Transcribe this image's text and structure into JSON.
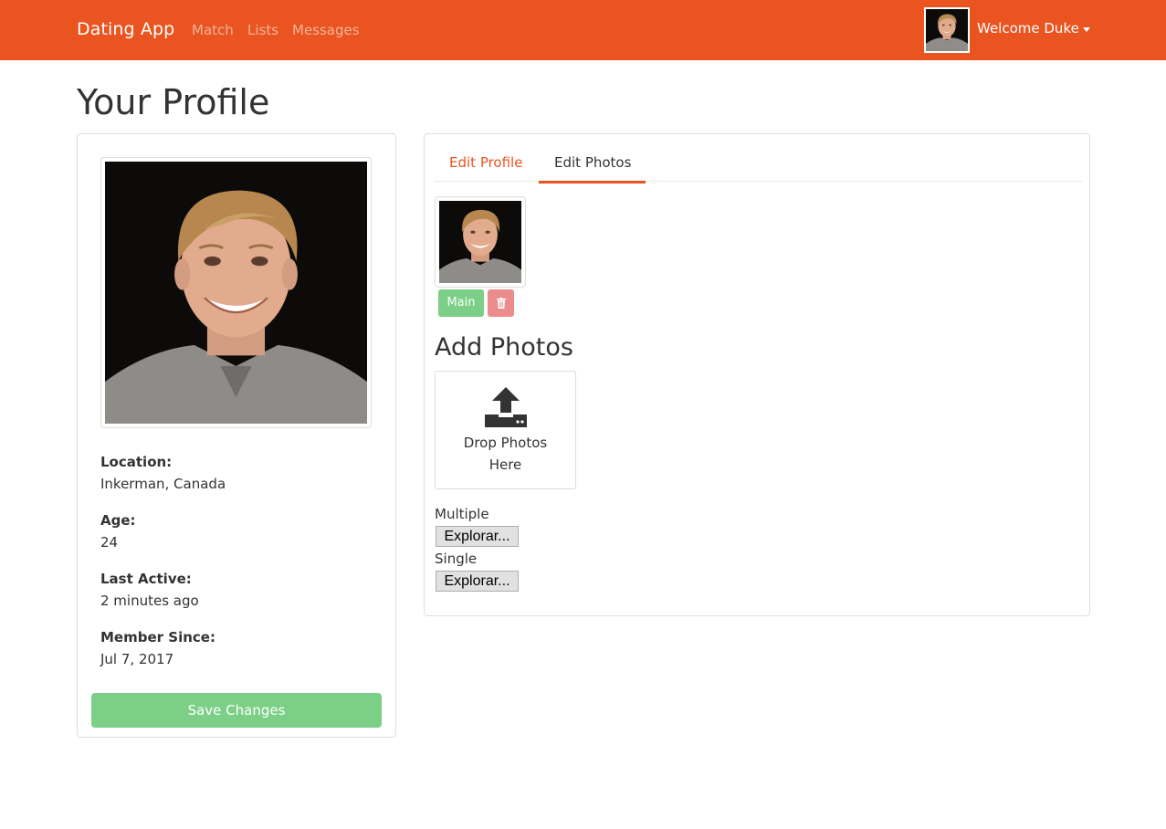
{
  "navbar": {
    "brand": "Dating App",
    "links": [
      "Match",
      "Lists",
      "Messages"
    ],
    "welcome": "Welcome Duke",
    "accent_color": "#e95420"
  },
  "page": {
    "title": "Your Profile"
  },
  "profile": {
    "location_label": "Location:",
    "location_value": "Inkerman, Canada",
    "age_label": "Age:",
    "age_value": "24",
    "last_active_label": "Last Active:",
    "last_active_value": "2 minutes ago",
    "member_since_label": "Member Since:",
    "member_since_value": "Jul 7, 2017",
    "save_button": "Save Changes"
  },
  "tabs": {
    "edit_profile": "Edit Profile",
    "edit_photos": "Edit Photos",
    "active": "Edit Photos"
  },
  "photos": {
    "main_button": "Main",
    "delete_icon": "trash-icon",
    "add_title": "Add Photos",
    "drop_text_line1": "Drop Photos",
    "drop_text_line2": "Here",
    "upload_icon": "upload-icon",
    "multiple_label": "Multiple",
    "single_label": "Single",
    "browse_button": "Explorar..."
  },
  "colors": {
    "success": "#7bcf86",
    "danger": "#ec8c8c"
  }
}
